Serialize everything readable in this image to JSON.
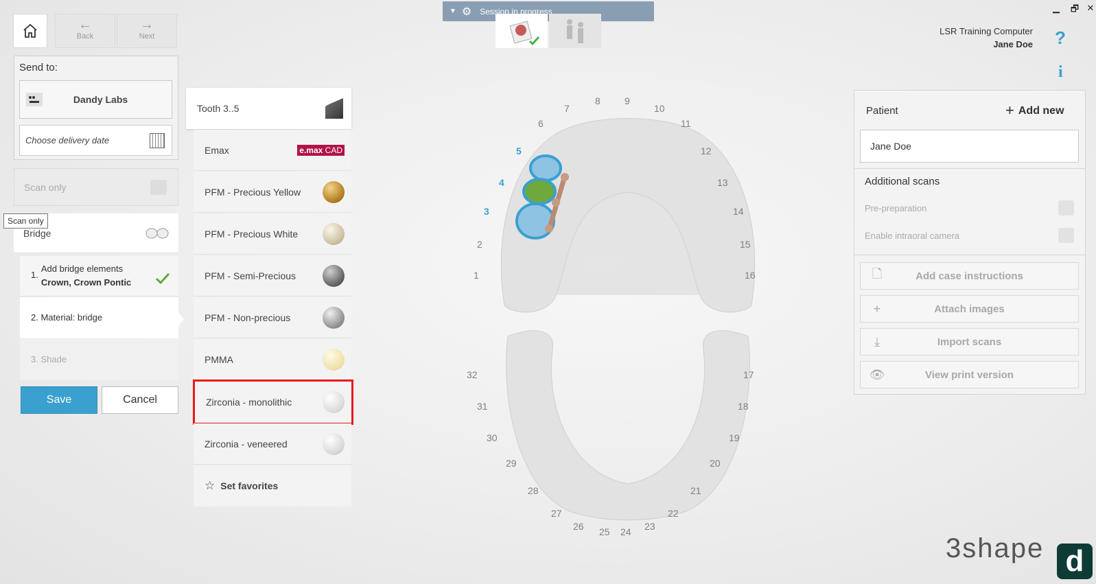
{
  "window": {
    "minimize": "▁",
    "maximize": "🗗",
    "close": "✕"
  },
  "nav": {
    "back_label": "Back",
    "next_label": "Next"
  },
  "session": {
    "label": "Session in progress"
  },
  "send": {
    "send_to_label": "Send to:",
    "lab_name": "Dandy Labs",
    "delivery_placeholder": "Choose delivery date",
    "scan_only_label": "Scan only",
    "tooltip": "Scan only",
    "bridge_label": "Bridge"
  },
  "steps": [
    {
      "num": "1.",
      "label": "Add bridge elements",
      "sub": "Crown, Crown Pontic"
    },
    {
      "label": "2. Material: bridge"
    },
    {
      "label": "3. Shade"
    }
  ],
  "buttons": {
    "save": "Save",
    "cancel": "Cancel"
  },
  "materials": {
    "header": "Tooth 3..5",
    "items": [
      {
        "label": "Emax",
        "logo_text": "e.max",
        "logo_sub": "CAD"
      },
      {
        "label": "PFM - Precious Yellow",
        "color": "#c8952d"
      },
      {
        "label": "PFM - Precious White",
        "color": "#d8cfb8"
      },
      {
        "label": "PFM - Semi-Precious",
        "color": "#6e6e6e"
      },
      {
        "label": "PFM - Non-precious",
        "color": "#9b9b9b"
      },
      {
        "label": "PMMA",
        "color": "#f2e4b8"
      },
      {
        "label": "Zirconia - monolithic",
        "color": "#f4f4f4"
      },
      {
        "label": "Zirconia - veneered",
        "color": "#f1f1f1"
      }
    ],
    "favorites": "Set favorites"
  },
  "teeth": {
    "upper": [
      "1",
      "2",
      "3",
      "4",
      "5",
      "6",
      "7",
      "8",
      "9",
      "10",
      "11",
      "12",
      "13",
      "14",
      "15",
      "16"
    ],
    "lower": [
      "17",
      "18",
      "19",
      "20",
      "21",
      "22",
      "23",
      "24",
      "25",
      "26",
      "27",
      "28",
      "29",
      "30",
      "31",
      "32"
    ],
    "highlighted": [
      "3",
      "4",
      "5"
    ]
  },
  "user": {
    "computer": "LSR Training Computer",
    "name": "Jane Doe"
  },
  "patient": {
    "label": "Patient",
    "add_new": "Add new",
    "name": "Jane Doe",
    "additional_scans": "Additional scans",
    "pre_preparation": "Pre-preparation",
    "intraoral_camera": "Enable intraoral camera",
    "actions": [
      "Add case instructions",
      "Attach images",
      "Import scans",
      "View print version"
    ]
  },
  "brand": {
    "logo": "3shape",
    "badge": "d"
  }
}
